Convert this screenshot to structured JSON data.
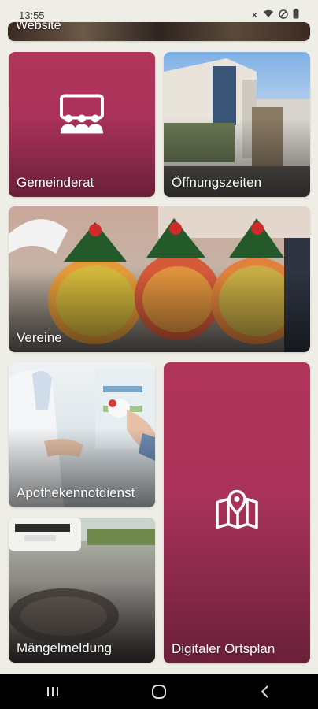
{
  "status_bar": {
    "time": "13:55"
  },
  "tiles": {
    "website": {
      "label": "Website"
    },
    "gemeinderat": {
      "label": "Gemeinderat"
    },
    "oeffnungszeiten": {
      "label": "Öffnungszeiten"
    },
    "vereine": {
      "label": "Vereine"
    },
    "apotheken": {
      "label": "Apothekennotdienst"
    },
    "maengel": {
      "label": "Mängelmeldung"
    },
    "ortsplan": {
      "label": "Digitaler Ortsplan"
    }
  },
  "icons": {
    "gemeinderat": "council-meeting-icon",
    "ortsplan": "map-location-icon",
    "nav_recent": "recent-apps-icon",
    "nav_home": "home-circle-icon",
    "nav_back": "back-chevron-icon"
  },
  "colors": {
    "accent": "#a9325a",
    "accent_dark": "#6a2038",
    "background": "#eeeee6"
  }
}
